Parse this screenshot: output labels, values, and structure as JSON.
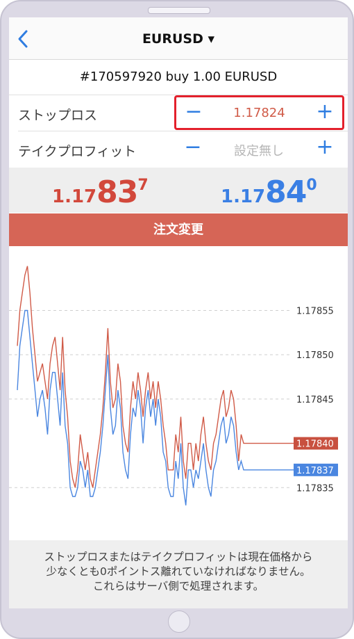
{
  "navbar": {
    "title": "EURUSD ▾",
    "back_icon": "chevron-left-icon"
  },
  "order": {
    "summary": "#170597920 buy 1.00 EURUSD"
  },
  "stop_loss": {
    "label": "ストップロス",
    "value": "1.17824",
    "minus": "−",
    "plus": "+"
  },
  "take_profit": {
    "label": "テイクプロフィット",
    "value": "設定無し",
    "minus": "−",
    "plus": "+"
  },
  "quotes": {
    "bid": {
      "small": "1.17",
      "big": "83",
      "pip": "7",
      "color": "#d2483b"
    },
    "ask": {
      "small": "1.17",
      "big": "84",
      "pip": "0",
      "color": "#3a7fe4"
    }
  },
  "modify_button": {
    "label": "注文変更"
  },
  "chart_data": {
    "type": "line",
    "y_ticks": [
      "1.17855",
      "1.17850",
      "1.17845",
      "1.17835"
    ],
    "ylim": [
      1.1783,
      1.17861
    ],
    "grid": true,
    "price_labels": [
      {
        "text": "1.17840",
        "value": 1.1784,
        "color": "#c8503f"
      },
      {
        "text": "1.17837",
        "value": 1.17837,
        "color": "#4a86e0"
      }
    ],
    "series": [
      {
        "color": "#d05a47",
        "values": [
          1.17851,
          1.17855,
          1.17857,
          1.17859,
          1.1786,
          1.17857,
          1.17853,
          1.1785,
          1.17847,
          1.17848,
          1.17849,
          1.17847,
          1.17845,
          1.17849,
          1.17851,
          1.17852,
          1.17849,
          1.17846,
          1.17852,
          1.17846,
          1.17843,
          1.17838,
          1.17836,
          1.17835,
          1.17837,
          1.17841,
          1.17839,
          1.17837,
          1.17839,
          1.17836,
          1.17835,
          1.17837,
          1.17839,
          1.17841,
          1.17844,
          1.17848,
          1.17853,
          1.17847,
          1.17844,
          1.17845,
          1.17849,
          1.17847,
          1.17842,
          1.1784,
          1.17839,
          1.17844,
          1.17847,
          1.17845,
          1.17848,
          1.17846,
          1.17843,
          1.17846,
          1.17848,
          1.17845,
          1.17847,
          1.17844,
          1.17847,
          1.17845,
          1.17842,
          1.1784,
          1.17837,
          1.17837,
          1.17837,
          1.17841,
          1.17839,
          1.17843,
          1.17838,
          1.17836,
          1.1784,
          1.1784,
          1.17837,
          1.1784,
          1.17838,
          1.17841,
          1.17843,
          1.1784,
          1.17838,
          1.17837,
          1.1784,
          1.17841,
          1.17843,
          1.17845,
          1.17846,
          1.17843,
          1.17844,
          1.17846,
          1.17845,
          1.17842,
          1.17838,
          1.17841,
          1.1784,
          1.1784,
          1.1784,
          1.1784,
          1.1784,
          1.1784,
          1.1784,
          1.1784,
          1.1784
        ]
      },
      {
        "color": "#4a86e0",
        "values": [
          1.17846,
          1.17851,
          1.17853,
          1.17855,
          1.17855,
          1.17852,
          1.17849,
          1.17846,
          1.17843,
          1.17845,
          1.17846,
          1.17844,
          1.17841,
          1.17846,
          1.17848,
          1.17848,
          1.17845,
          1.17842,
          1.17848,
          1.17842,
          1.1784,
          1.17835,
          1.17834,
          1.17834,
          1.17835,
          1.17838,
          1.17837,
          1.17835,
          1.17837,
          1.17834,
          1.17834,
          1.17835,
          1.17837,
          1.17839,
          1.17842,
          1.17846,
          1.1785,
          1.17844,
          1.17841,
          1.17842,
          1.17846,
          1.17844,
          1.17839,
          1.17837,
          1.17836,
          1.17841,
          1.17844,
          1.17843,
          1.17846,
          1.17844,
          1.1784,
          1.17844,
          1.17846,
          1.17843,
          1.17845,
          1.17842,
          1.17845,
          1.17843,
          1.17839,
          1.17838,
          1.17835,
          1.17834,
          1.17834,
          1.17838,
          1.17836,
          1.1784,
          1.17835,
          1.17833,
          1.17837,
          1.17837,
          1.17835,
          1.17837,
          1.17836,
          1.17838,
          1.1784,
          1.17837,
          1.17835,
          1.17834,
          1.17837,
          1.17838,
          1.1784,
          1.17842,
          1.17843,
          1.1784,
          1.17841,
          1.17843,
          1.17842,
          1.17839,
          1.17837,
          1.17838,
          1.17837,
          1.17837,
          1.17837,
          1.17837,
          1.17837,
          1.17837,
          1.17837,
          1.17837,
          1.17837
        ]
      }
    ]
  },
  "footer": {
    "lines": [
      "ストップロスまたはテイクプロフィットは現在価格から",
      "少なくとも0ポイントス離れていなければなりません。",
      "これらはサーバ側で処理されます。"
    ]
  }
}
